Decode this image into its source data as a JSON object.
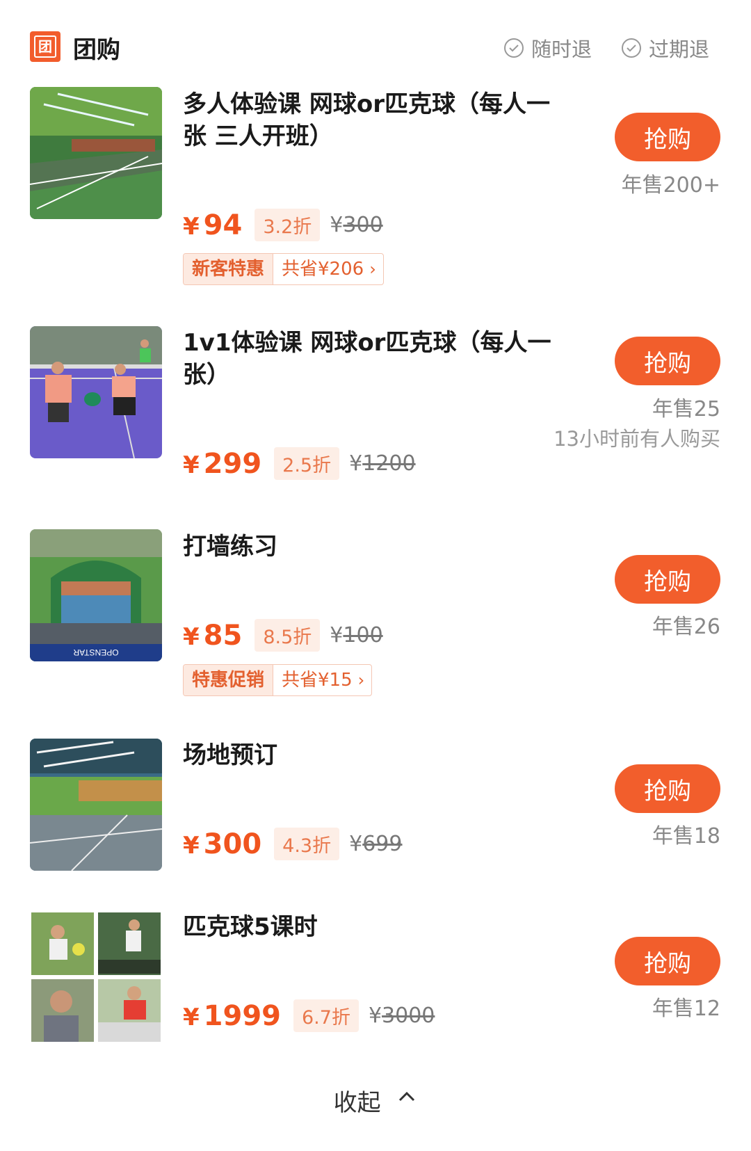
{
  "header": {
    "logo_char": "团",
    "title": "团购",
    "guarantees": [
      "随时退",
      "过期退"
    ]
  },
  "colors": {
    "accent": "#f25e2c",
    "price": "#f0541e",
    "muted": "#888888"
  },
  "deals": [
    {
      "title": "多人体验课 网球or匹克球（每人一张 三人开班）",
      "price": "94",
      "discount": "3.2折",
      "original": "300",
      "promo_tag": "新客特惠",
      "promo_save": "共省¥206",
      "buy_label": "抢购",
      "sales": "年售200+",
      "image": "indoor-court-photo"
    },
    {
      "title": "1v1体验课 网球or匹克球（每人一张）",
      "price": "299",
      "discount": "2.5折",
      "original": "1200",
      "buy_label": "抢购",
      "sales": "年售25",
      "recent": "13小时前有人购买",
      "image": "players-on-court-photo"
    },
    {
      "title": "打墙练习",
      "price": "85",
      "discount": "8.5折",
      "original": "100",
      "promo_tag": "特惠促销",
      "promo_save": "共省¥15",
      "buy_label": "抢购",
      "sales": "年售26",
      "image": "practice-wall-photo"
    },
    {
      "title": "场地预订",
      "price": "300",
      "discount": "4.3折",
      "original": "699",
      "buy_label": "抢购",
      "sales": "年售18",
      "image": "venue-photo"
    },
    {
      "title": "匹克球5课时",
      "price": "1999",
      "discount": "6.7折",
      "original": "3000",
      "buy_label": "抢购",
      "sales": "年售12",
      "image": "collage-players-photo"
    }
  ],
  "currency": "¥",
  "collapse_label": "收起"
}
